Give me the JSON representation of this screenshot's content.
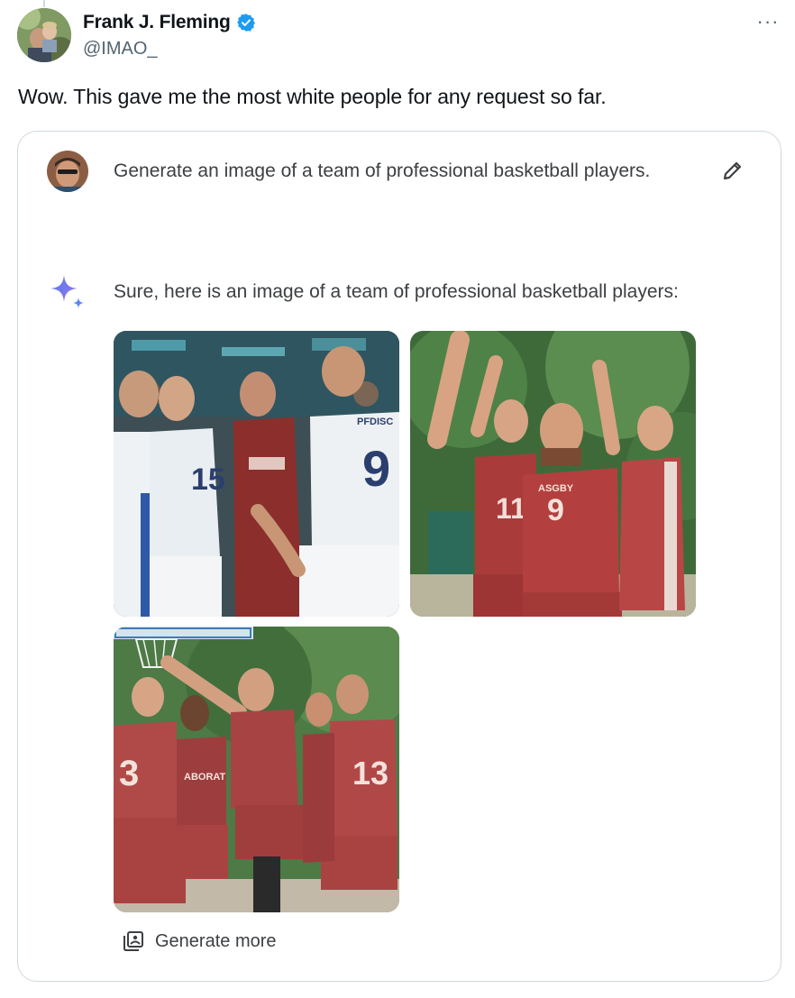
{
  "tweet": {
    "author_name": "Frank J. Fleming",
    "handle": "@IMAO_",
    "text": "Wow. This gave me the most white people for any request so far.",
    "more_label": "···"
  },
  "card": {
    "prompt": "Generate an image of a team of professional basketball players.",
    "response": "Sure, here is an image of a team of professional basketball players:",
    "generate_more_label": "Generate more"
  },
  "images": [
    {
      "jersey_numbers": [
        "15",
        "9"
      ],
      "print_texts": [
        "PFDISC"
      ]
    },
    {
      "jersey_numbers": [
        "11",
        "9"
      ],
      "print_texts": [
        "ASGBY"
      ]
    },
    {
      "jersey_numbers": [
        "3",
        "13"
      ],
      "print_texts": [
        "ABORAT"
      ]
    }
  ],
  "colors": {
    "verified_badge": "#1d9bf0",
    "text_primary": "#0f1419",
    "text_secondary": "#536471",
    "card_border": "#cfd9de",
    "gemini_text": "#3c4043"
  },
  "icons": {
    "verified": "verified-badge-icon",
    "more": "more-options-icon",
    "edit": "pencil-edit-icon",
    "sparkle": "gemini-sparkle-icon",
    "generate_more": "image-stack-icon"
  }
}
